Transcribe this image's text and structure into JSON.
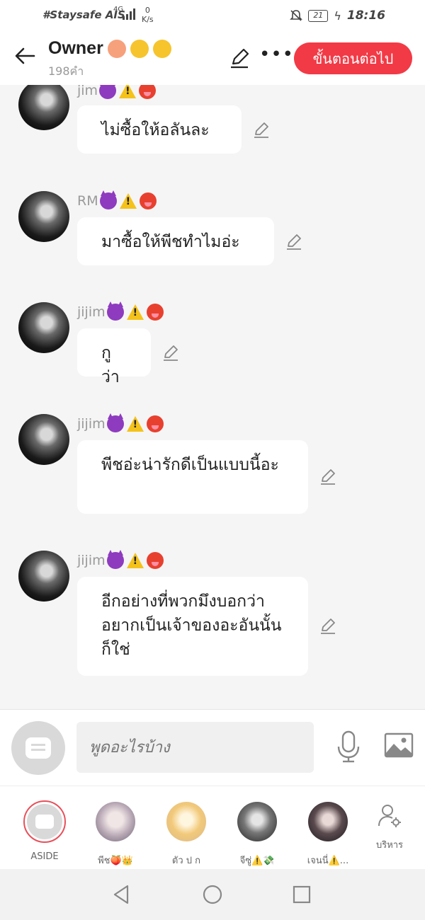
{
  "status_bar": {
    "carrier": "#Staysafe AIS",
    "network": "4G",
    "speed_value": "0",
    "speed_unit": "K/s",
    "battery": "21",
    "time": "18:16"
  },
  "header": {
    "title": "Owner",
    "message_count": "198คำ",
    "next_button": "ขั้นตอนต่อไป"
  },
  "messages": [
    {
      "name": "jim",
      "text": "ไม่ซื้อให้อลันละ"
    },
    {
      "name": "RM",
      "text": "มาซื้อให้พีชทำไมอ่ะ"
    },
    {
      "name": "jijim",
      "text": "กูว่า"
    },
    {
      "name": "jijim",
      "text": "พีชอ่ะน่ารักดีเป็นแบบนี้อะ"
    },
    {
      "name": "jijim",
      "text": "อีกอย่างที่พวกมึงบอกว่าอยากเป็นเจ้าของอะอันนั้นก็ใช่"
    }
  ],
  "composer": {
    "placeholder": "พูดอะไรบ้าง"
  },
  "characters": [
    {
      "label": "ASIDE"
    },
    {
      "label": "พีช🍑👑"
    },
    {
      "label": "ตัว ป ก"
    },
    {
      "label": "จีซู่⚠️💸"
    },
    {
      "label": "เจนนี่⚠️..."
    }
  ],
  "manage_label": "บริหาร",
  "colors": {
    "accent": "#f23a46",
    "background": "#f5f5f5",
    "bubble": "#ffffff",
    "name": "#9a9a9a"
  }
}
